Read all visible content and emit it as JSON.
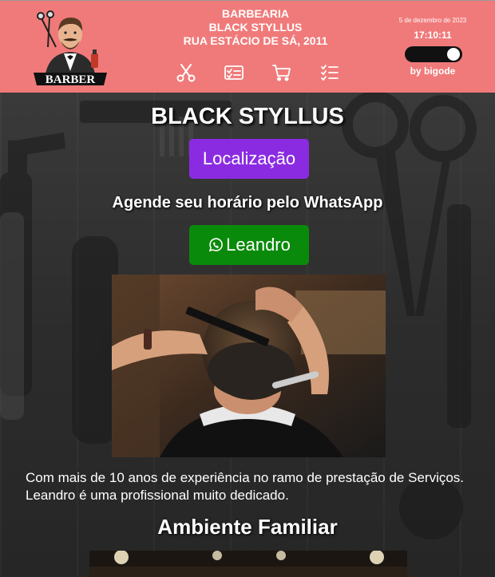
{
  "header": {
    "logo_text": "BARBER",
    "title_line1": "BARBEARIA",
    "title_line2": "BLACK STYLLUS",
    "title_line3": "RUA ESTÁCIO DE SÁ, 2011",
    "date": "5 de dezembro de 2023",
    "time": "17:10:11",
    "byline": "by bigode",
    "toggle_on": true,
    "nav_icons": [
      "scissors-icon",
      "id-card-icon",
      "cart-icon",
      "checklist-icon"
    ]
  },
  "main": {
    "title": "BLACK STYLLUS",
    "location_button": "Localização",
    "schedule_text": "Agende seu horário pelo WhatsApp",
    "whatsapp_button": "Leandro",
    "description": "Com mais de 10 anos de experiência no ramo de prestação de Serviços. Leandro é uma profissional muito dedicado.",
    "section_title": "Ambiente Familiar"
  },
  "colors": {
    "header_bg": "#f07a7a",
    "location_button_bg": "#8a2be2",
    "whatsapp_button_bg": "#0a8a0a"
  }
}
